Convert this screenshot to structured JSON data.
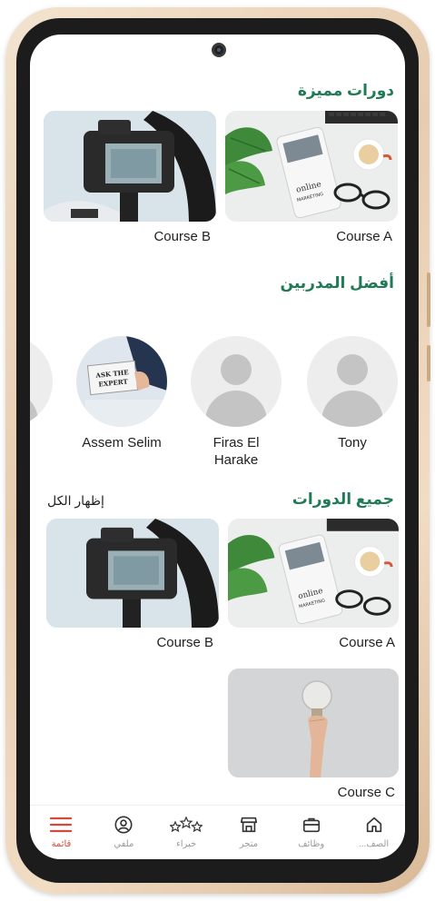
{
  "featured": {
    "title": "دورات مميزة",
    "courses": [
      {
        "label": "Course A",
        "thumb": "marketing"
      },
      {
        "label": "Course B",
        "thumb": "camera"
      }
    ]
  },
  "trainers": {
    "title": "أفضل المدربين",
    "items": [
      {
        "name": "Tony",
        "avatar": "placeholder"
      },
      {
        "name": "Firas El Harake",
        "name_line1": "Firas El",
        "name_line2": "Harake",
        "avatar": "placeholder"
      },
      {
        "name": "Assem Selim",
        "avatar": "ask-the-expert-photo",
        "sign_line1": "ASK THE",
        "sign_line2": "EXPERT"
      },
      {
        "name": "",
        "avatar": "partial-placeholder"
      }
    ]
  },
  "all_courses": {
    "title": "جميع الدورات",
    "show_all": "إظهار الكل",
    "courses": [
      {
        "label": "Course A",
        "thumb": "marketing"
      },
      {
        "label": "Course B",
        "thumb": "camera"
      },
      {
        "label": "Course C",
        "thumb": "lightbulb"
      }
    ]
  },
  "marketing_thumb_text": {
    "line1": "online",
    "line2": "MARKETING"
  },
  "bottom_nav": {
    "items": [
      {
        "label": "الصف...",
        "icon": "home-icon"
      },
      {
        "label": "وظائف",
        "icon": "briefcase-icon"
      },
      {
        "label": "متجر",
        "icon": "store-icon"
      },
      {
        "label": "خبراء",
        "icon": "stars-icon"
      },
      {
        "label": "ملفي",
        "icon": "profile-icon"
      },
      {
        "label": "قائمة",
        "icon": "menu-icon",
        "active": true
      }
    ]
  },
  "colors": {
    "accent_green": "#1f7a55",
    "active_red": "#d54a3a",
    "frame_gold": "#e7cdb0"
  }
}
